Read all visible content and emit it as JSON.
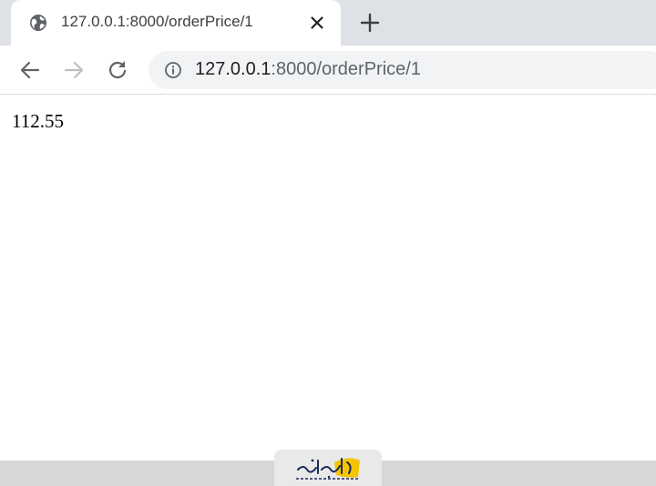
{
  "browser": {
    "tab": {
      "title": "127.0.0.1:8000/orderPrice/1",
      "favicon": "globe-icon"
    },
    "address_bar": {
      "host": "127.0.0.1",
      "path": ":8000/orderPrice/1"
    },
    "nav_icons": [
      "back-arrow-icon",
      "forward-arrow-icon",
      "reload-icon",
      "site-info-icon"
    ]
  },
  "page": {
    "body_text": "112.55"
  },
  "watermark": {
    "name": "logo-watermark"
  },
  "colors": {
    "tabstrip": "#dee1e6",
    "omnibox": "#f1f3f4",
    "text": "#202124",
    "muted": "#5f6368",
    "disabled": "#bdc1c6",
    "logo_accent": "#f5c400"
  }
}
